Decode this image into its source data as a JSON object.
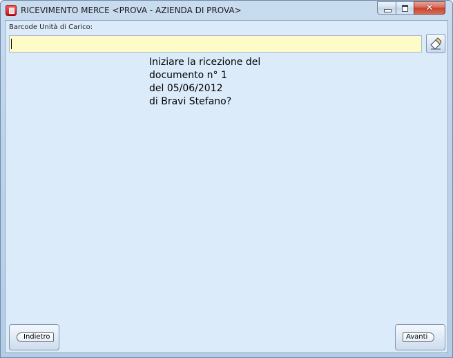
{
  "window": {
    "title": "RICEVIMENTO MERCE <PROVA - AZIENDA DI PROVA>",
    "icon": "app-icon"
  },
  "titlebar_buttons": {
    "minimize_icon": "minimize-icon",
    "maximize_icon": "maximize-icon",
    "close_icon": "close-icon",
    "close_glyph": "✕"
  },
  "barcode": {
    "label": "Barcode Unità di Carico:",
    "value": "",
    "placeholder": "",
    "clear_icon": "eraser-icon"
  },
  "message": {
    "lines": [
      "Iniziare la ricezione del",
      "documento n° 1",
      "del 05/06/2012",
      "di Bravi Stefano?"
    ]
  },
  "navigation": {
    "back_label": "Indietro",
    "next_label": "Avanti"
  },
  "colors": {
    "input_background": "#fdfbc8",
    "client_background": "#dcebfa",
    "close_button": "#c5432f"
  }
}
